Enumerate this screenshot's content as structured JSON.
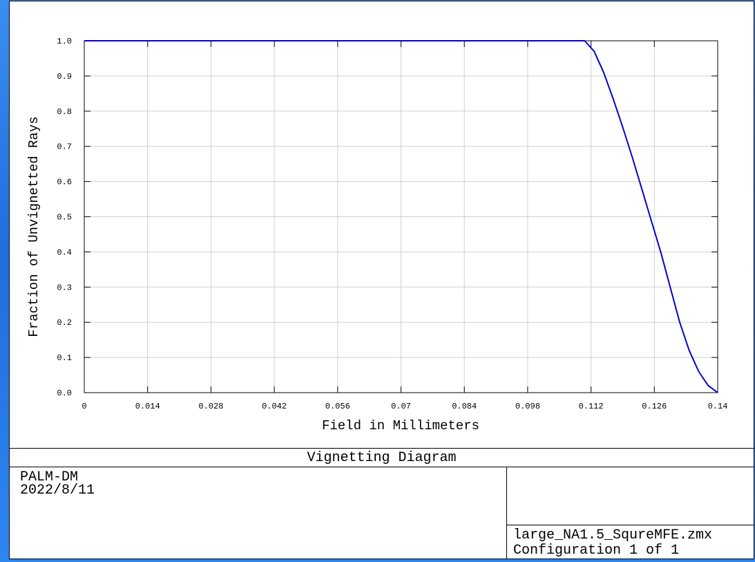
{
  "chart_data": {
    "type": "line",
    "title": "Vignetting Diagram",
    "xlabel": "Field in Millimeters",
    "ylabel": "Fraction of Unvignetted Rays",
    "xlim": [
      0,
      0.14
    ],
    "ylim": [
      0,
      1.0
    ],
    "x_ticks": [
      "0",
      "0.014",
      "0.028",
      "0.042",
      "0.056",
      "0.07",
      "0.084",
      "0.098",
      "0.112",
      "0.126",
      "0.14"
    ],
    "x_tick_values": [
      0,
      0.014,
      0.028,
      0.042,
      0.056,
      0.07,
      0.084,
      0.098,
      0.112,
      0.126,
      0.14
    ],
    "y_ticks": [
      "0.0",
      "0.1",
      "0.2",
      "0.3",
      "0.4",
      "0.5",
      "0.6",
      "0.7",
      "0.8",
      "0.9",
      "1.0"
    ],
    "y_tick_values": [
      0,
      0.1,
      0.2,
      0.3,
      0.4,
      0.5,
      0.6,
      0.7,
      0.8,
      0.9,
      1.0
    ],
    "grid": true,
    "series": [
      {
        "color": "#0000cc",
        "x": [
          0,
          0.1106,
          0.1127,
          0.1148,
          0.1169,
          0.119,
          0.1211,
          0.1232,
          0.1253,
          0.1274,
          0.1295,
          0.1316,
          0.1337,
          0.1358,
          0.1379,
          0.14
        ],
        "y": [
          1.0,
          1.0,
          0.97,
          0.91,
          0.835,
          0.755,
          0.67,
          0.58,
          0.49,
          0.4,
          0.3,
          0.2,
          0.12,
          0.06,
          0.02,
          0.0
        ]
      }
    ]
  },
  "footer": {
    "title": "Vignetting Diagram",
    "left_line1": "PALM-DM",
    "left_line2": "2022/8/11",
    "right_line1": "large_NA1.5_SqureMFE.zmx",
    "right_line2": "Configuration 1 of 1"
  }
}
